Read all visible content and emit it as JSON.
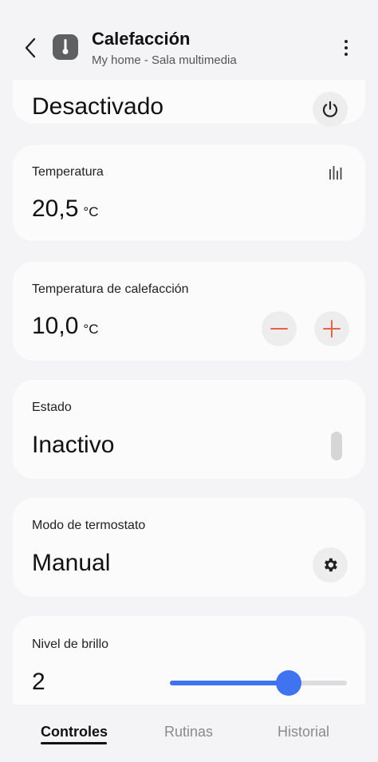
{
  "header": {
    "title": "Calefacción",
    "subtitle": "My home - Sala multimedia"
  },
  "cards": {
    "power": {
      "value": "Desactivado"
    },
    "temperature": {
      "label": "Temperatura",
      "value": "20,5",
      "unit": "°C"
    },
    "heating_setpoint": {
      "label": "Temperatura de calefacción",
      "value": "10,0",
      "unit": "°C"
    },
    "state": {
      "label": "Estado",
      "value": "Inactivo"
    },
    "thermostat_mode": {
      "label": "Modo de termostato",
      "value": "Manual"
    },
    "brightness": {
      "label": "Nivel de brillo",
      "value": "2",
      "level_fraction": 0.67
    }
  },
  "tabs": [
    {
      "label": "Controles",
      "active": true
    },
    {
      "label": "Rutinas",
      "active": false
    },
    {
      "label": "Historial",
      "active": false
    }
  ],
  "colors": {
    "accent": "#3f73f0",
    "minus_plus": "#e8604a",
    "background": "#f4f4f6",
    "card": "#fbfbfc"
  },
  "icons": {
    "back": "chevron-left-icon",
    "device": "thermometer-icon",
    "more": "more-vertical-icon",
    "power": "power-icon",
    "history": "bar-chart-icon",
    "minus": "minus-icon",
    "plus": "plus-icon",
    "settings": "gear-icon"
  }
}
